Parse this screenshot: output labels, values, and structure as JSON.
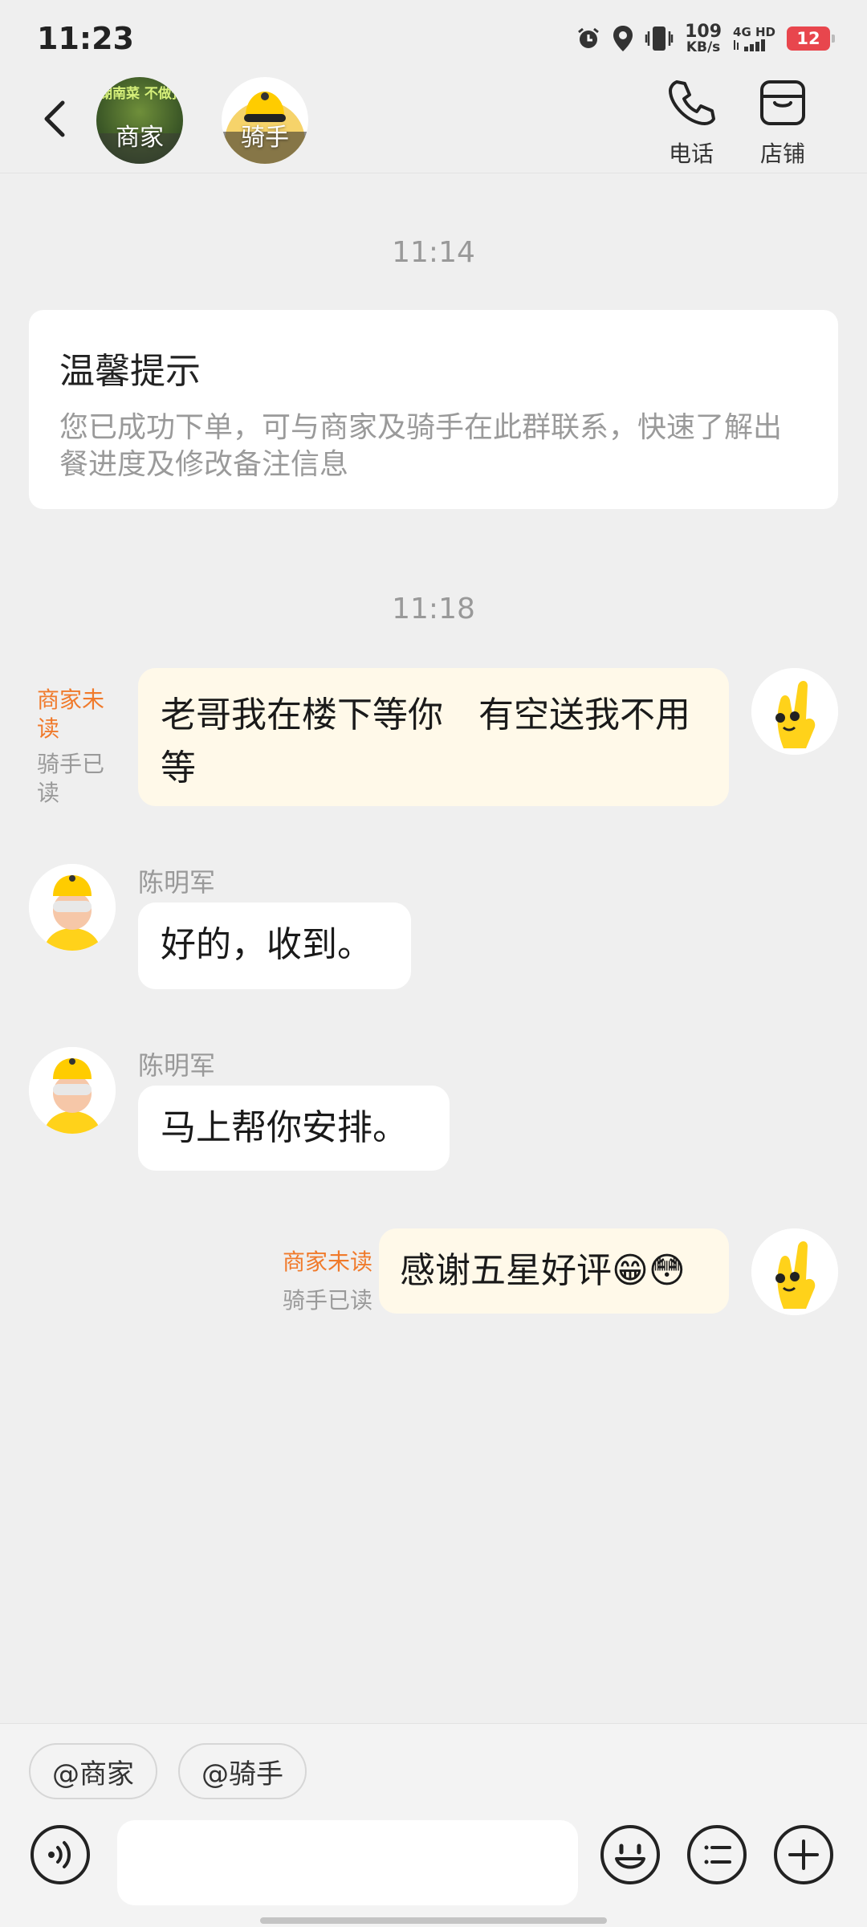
{
  "status_bar": {
    "time": "11:23",
    "speed_value": "109",
    "speed_unit": "KB/s",
    "network": "4G HD",
    "battery": "12"
  },
  "header": {
    "merchant_label": "商家",
    "rider_label": "骑手",
    "phone_label": "电话",
    "store_label": "店铺",
    "merchant_logo_text": "现炒 湖南菜 不做预制菜"
  },
  "messages": {
    "time1": "11:14",
    "tip_title": "温馨提示",
    "tip_body": "您已成功下单，可与商家及骑手在此群联系，快速了解出餐进度及修改备注信息",
    "time2": "11:18",
    "msg1": {
      "status_merchant": "商家未读",
      "status_rider": "骑手已读",
      "text": "老哥我在楼下等你　有空送我不用等"
    },
    "msg2": {
      "sender": "陈明军",
      "text": "好的，收到。"
    },
    "msg3": {
      "sender": "陈明军",
      "text": "马上帮你安排。"
    },
    "msg4": {
      "status_merchant": "商家未读",
      "status_rider": "骑手已读",
      "text": "感谢五星好评😁😳"
    }
  },
  "bottom": {
    "mention_merchant": "@商家",
    "mention_rider": "@骑手",
    "input_value": ""
  },
  "colors": {
    "accent_unread": "#f07a2b",
    "my_bubble": "#fff9e9",
    "background": "#efefef"
  }
}
